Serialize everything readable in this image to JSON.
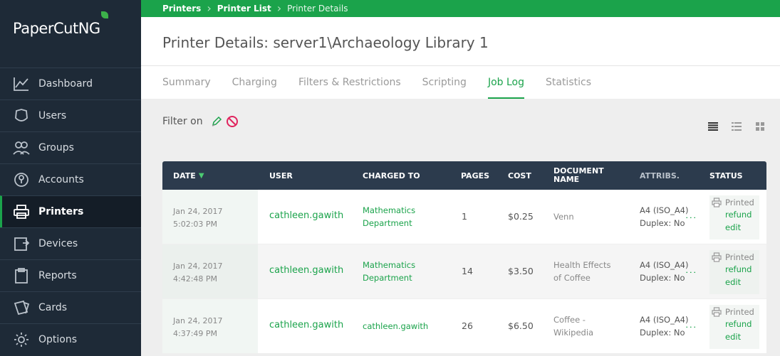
{
  "app": {
    "logo_text": "PaperCut",
    "logo_suffix": "NG"
  },
  "sidebar": {
    "items": [
      {
        "label": "Dashboard",
        "icon": "dashboard-icon",
        "active": false
      },
      {
        "label": "Users",
        "icon": "users-icon",
        "active": false
      },
      {
        "label": "Groups",
        "icon": "groups-icon",
        "active": false
      },
      {
        "label": "Accounts",
        "icon": "accounts-icon",
        "active": false
      },
      {
        "label": "Printers",
        "icon": "printer-icon",
        "active": true
      },
      {
        "label": "Devices",
        "icon": "devices-icon",
        "active": false
      },
      {
        "label": "Reports",
        "icon": "reports-icon",
        "active": false
      },
      {
        "label": "Cards",
        "icon": "cards-icon",
        "active": false
      },
      {
        "label": "Options",
        "icon": "gear-icon",
        "active": false
      }
    ]
  },
  "breadcrumb": [
    "Printers",
    "Printer List",
    "Printer Details"
  ],
  "page": {
    "title": "Printer Details: server1\\Archaeology Library 1"
  },
  "tabs": [
    {
      "label": "Summary",
      "active": false
    },
    {
      "label": "Charging",
      "active": false
    },
    {
      "label": "Filters & Restrictions",
      "active": false
    },
    {
      "label": "Scripting",
      "active": false
    },
    {
      "label": "Job Log",
      "active": true
    },
    {
      "label": "Statistics",
      "active": false
    }
  ],
  "filter": {
    "label": "Filter on",
    "edit_icon": "pencil-icon",
    "clear_icon": "no-filter-icon"
  },
  "view_icons": [
    "list-compact-icon",
    "list-detail-icon",
    "grid-icon"
  ],
  "table": {
    "columns": {
      "date": "DATE",
      "user": "USER",
      "charged_to": "CHARGED TO",
      "pages": "PAGES",
      "cost": "COST",
      "document_line1": "DOCUMENT",
      "document_line2": "NAME",
      "attribs": "ATTRIBS.",
      "status": "STATUS"
    },
    "rows": [
      {
        "date": "Jan 24, 2017",
        "time": "5:02:03 PM",
        "user": "cathleen.gawith",
        "charged_line1": "Mathematics",
        "charged_line2": "Department",
        "pages": "1",
        "cost": "$0.25",
        "doc_line1": "Venn",
        "doc_line2": "",
        "attr_line1": "A4 (ISO_A4)",
        "attr_line2": "Duplex: No",
        "status": "Printed",
        "link1": "refund",
        "link2": "edit"
      },
      {
        "date": "Jan 24, 2017",
        "time": "4:42:48 PM",
        "user": "cathleen.gawith",
        "charged_line1": "Mathematics",
        "charged_line2": "Department",
        "pages": "14",
        "cost": "$3.50",
        "doc_line1": "Health Effects",
        "doc_line2": "of Coffee",
        "attr_line1": "A4 (ISO_A4)",
        "attr_line2": "Duplex: No",
        "status": "Printed",
        "link1": "refund",
        "link2": "edit"
      },
      {
        "date": "Jan 24, 2017",
        "time": "4:37:49 PM",
        "user": "cathleen.gawith",
        "charged_line1": "cathleen.gawith",
        "charged_line2": "",
        "pages": "26",
        "cost": "$6.50",
        "doc_line1": "Coffee -",
        "doc_line2": "Wikipedia",
        "attr_line1": "A4 (ISO_A4)",
        "attr_line2": "Duplex: No",
        "status": "Printed",
        "link1": "refund",
        "link2": "edit"
      }
    ]
  },
  "colors": {
    "brand_green": "#1ba34b",
    "sidebar_bg": "#1e2a37",
    "table_header_bg": "#2c3b4d"
  }
}
